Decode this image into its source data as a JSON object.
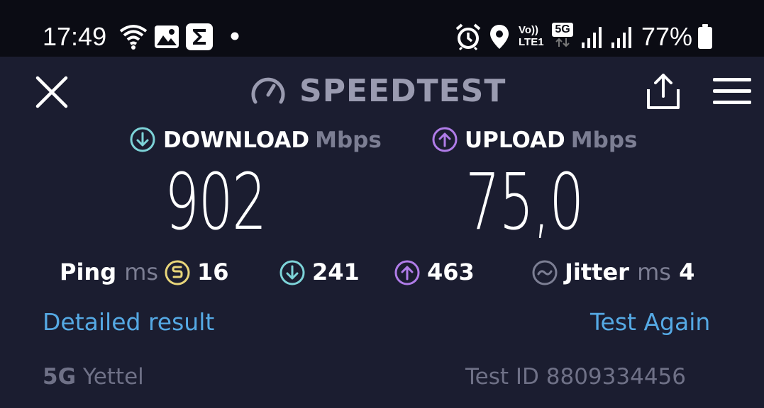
{
  "status_bar": {
    "time": "17:49",
    "network_top": "Vo))",
    "network_bottom": "LTE1",
    "five_g": "5G",
    "battery": "77%",
    "icons": [
      "wifi-icon",
      "gallery-icon",
      "sigma-icon",
      "dot-icon",
      "alarm-icon",
      "location-icon",
      "volte-icon",
      "5g-icon",
      "signal-icon",
      "signal-icon",
      "battery-icon"
    ]
  },
  "header": {
    "title": "SPEEDTEST",
    "icons": [
      "close-icon",
      "speedometer-icon",
      "share-icon",
      "menu-icon"
    ]
  },
  "download": {
    "label": "DOWNLOAD",
    "unit": "Mbps",
    "value": "902",
    "color": "#7dd3d8"
  },
  "upload": {
    "label": "UPLOAD",
    "unit": "Mbps",
    "value": "75,0",
    "color": "#b07ce8"
  },
  "stats": {
    "ping_label": "Ping",
    "ping_unit": "ms",
    "ping_value": "16",
    "ping_color": "#e8d57a",
    "download_latency": "241",
    "upload_latency": "463",
    "jitter_label": "Jitter",
    "jitter_unit": "ms",
    "jitter_value": "4"
  },
  "actions": {
    "detailed": "Detailed result",
    "again": "Test Again",
    "link_color": "#55a9e4"
  },
  "footer": {
    "network_type": "5G",
    "carrier": "Yettel",
    "test_id": "Test ID 8809334456"
  }
}
